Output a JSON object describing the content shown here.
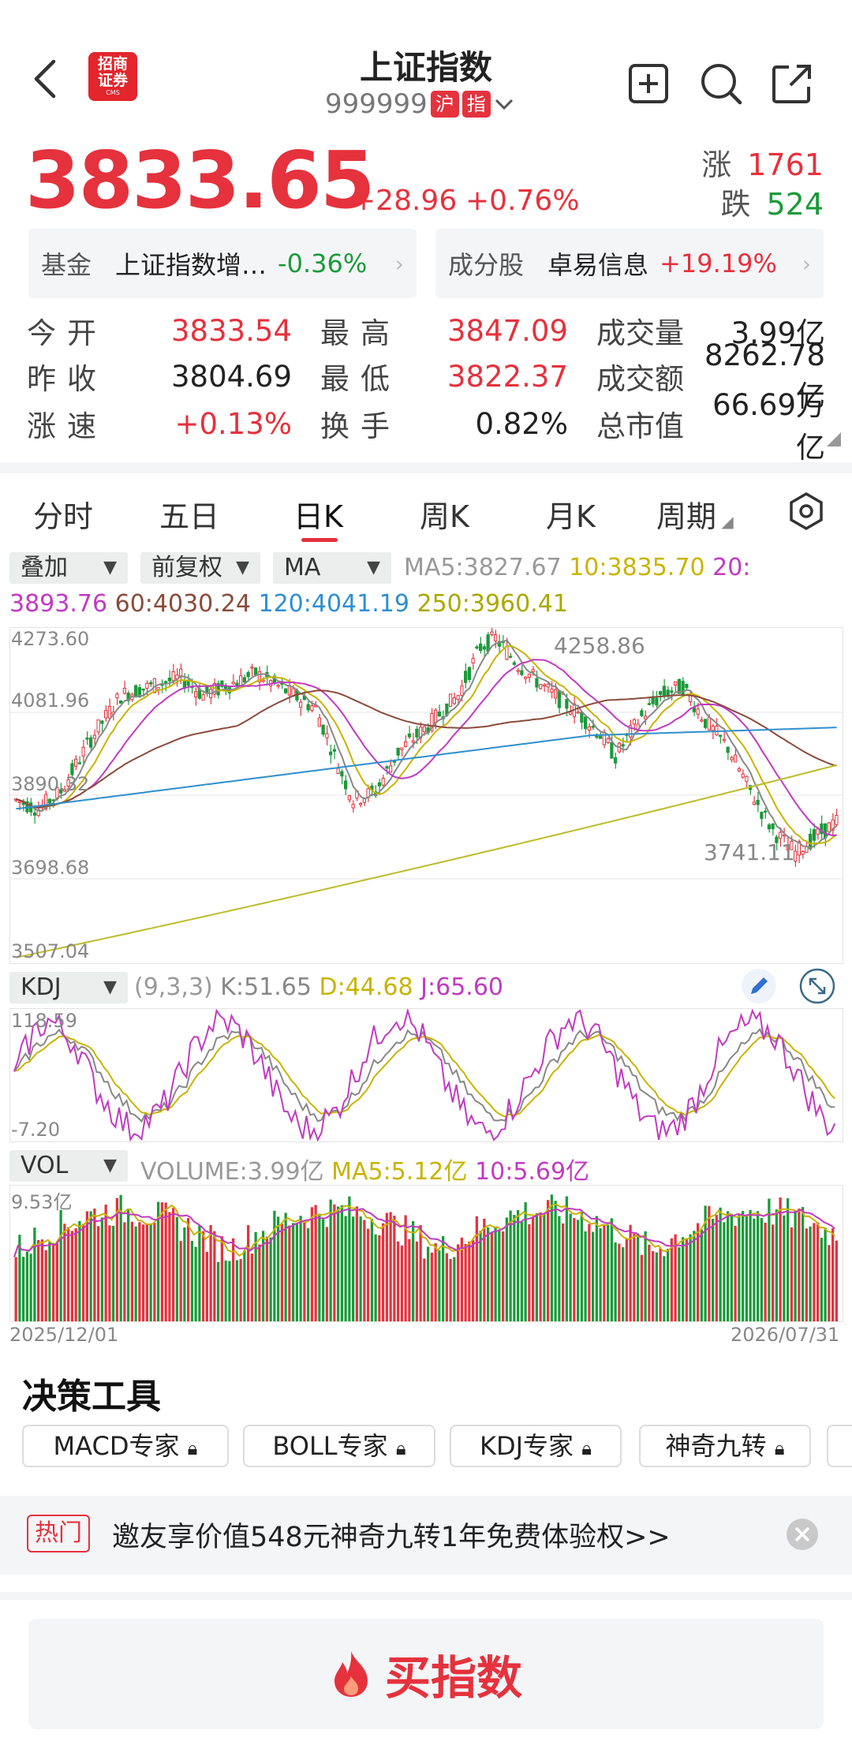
{
  "header": {
    "title": "上证指数",
    "code": "999999",
    "badge1": "沪",
    "badge2": "指",
    "logo_top": "招商",
    "logo_mid": "证券",
    "logo_small": "CMS"
  },
  "quote": {
    "price": "3833.65",
    "change": "+28.96",
    "change_pct": "+0.76%",
    "up_label": "涨",
    "up_count": "1761",
    "down_label": "跌",
    "down_count": "524"
  },
  "cards": {
    "fund_label": "基金",
    "fund_name": "上证指数增…",
    "fund_pct": "-0.36%",
    "stock_label": "成分股",
    "stock_name": "卓易信息",
    "stock_pct": "+19.19%"
  },
  "stats": [
    [
      {
        "label": "今开",
        "value": "3833.54",
        "color": "red"
      },
      {
        "label": "最高",
        "value": "3847.09",
        "color": "red"
      },
      {
        "label": "成交量",
        "value": "3.99亿",
        "color": "dark"
      }
    ],
    [
      {
        "label": "昨收",
        "value": "3804.69",
        "color": "dark"
      },
      {
        "label": "最低",
        "value": "3822.37",
        "color": "red"
      },
      {
        "label": "成交额",
        "value": "8262.78亿",
        "color": "dark"
      }
    ],
    [
      {
        "label": "涨速",
        "value": "+0.13%",
        "color": "red"
      },
      {
        "label": "换手",
        "value": "0.82%",
        "color": "dark"
      },
      {
        "label": "总市值",
        "value": "66.69万亿",
        "color": "dark"
      }
    ]
  ],
  "tabs": [
    "分时",
    "五日",
    "日K",
    "周K",
    "月K",
    "周期"
  ],
  "toolbar": {
    "overlay": "叠加",
    "adjust": "前复权",
    "ma": "MA",
    "ma5": "MA5:3827.67",
    "ma10": "10:3835.70",
    "ma20_label": "20:",
    "ma20_val": "3893.76",
    "ma60": "60:4030.24",
    "ma120": "120:4041.19",
    "ma250": "250:3960.41"
  },
  "chart_labels": {
    "y1": "4273.60",
    "y2": "4081.96",
    "y3": "3890.32",
    "y4": "3698.68",
    "y5": "3507.04",
    "high_mark": "4258.86",
    "low_mark": "3741.11"
  },
  "kdj": {
    "name": "KDJ",
    "params": "(9,3,3)",
    "k": "K:51.65",
    "d": "D:44.68",
    "j": "J:65.60",
    "top": "118.59",
    "bottom": "-7.20"
  },
  "vol": {
    "name": "VOL",
    "volume": "VOLUME:3.99亿",
    "ma5": "MA5:5.12亿",
    "ma10": "10:5.69亿",
    "top": "9.53亿",
    "date_start": "2025/12/01",
    "date_end": "2026/07/31"
  },
  "tools": {
    "title": "决策工具",
    "items": [
      "MACD专家",
      "BOLL专家",
      "KDJ专家",
      "神奇九转"
    ]
  },
  "promo": {
    "tag": "热门",
    "text": "邀友享价值548元神奇九转1年免费体验权>>"
  },
  "buy": {
    "label": "买指数"
  },
  "colors": {
    "red": "#e5323d",
    "green": "#1a9a3a",
    "ma5": "#888888",
    "ma10": "#c8b400",
    "ma20": "#c23ac2",
    "ma60": "#8b4b3a",
    "ma120": "#2f8fd0",
    "ma250": "#b8b800"
  }
}
